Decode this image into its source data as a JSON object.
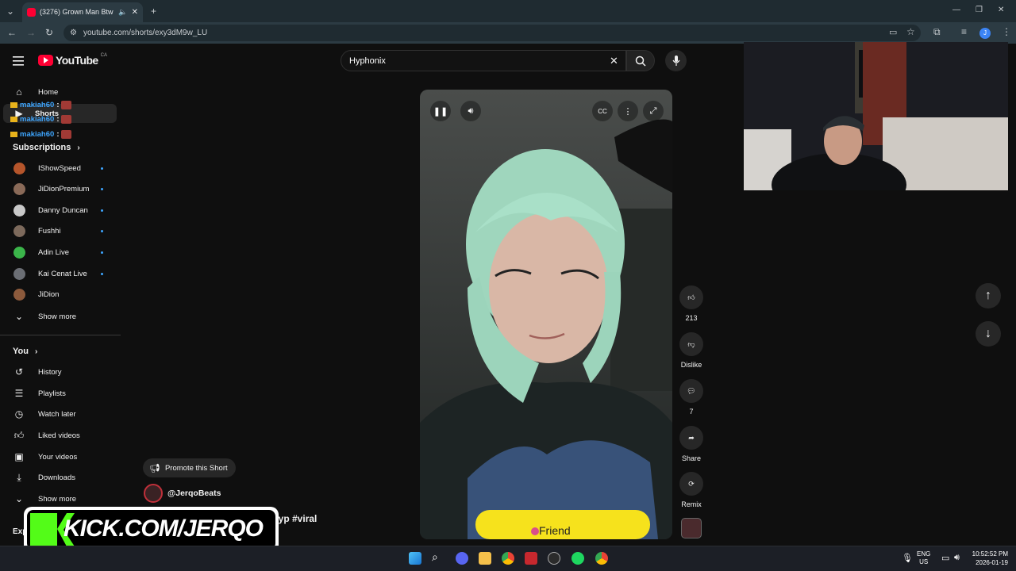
{
  "browser": {
    "tab_title": "(3276) Grown Man Btw 😂",
    "url": "youtube.com/shorts/exy3dM9w_LU"
  },
  "youtube": {
    "logo_text": "YouTube",
    "logo_region": "CA",
    "search_value": "Hyphonix"
  },
  "sidebar": {
    "home": "Home",
    "shorts": "Shorts",
    "subscriptions_title": "Subscriptions",
    "subscriptions": [
      {
        "name": "IShowSpeed",
        "color": "#b5552b"
      },
      {
        "name": "JiDionPremium",
        "color": "#8a6a58"
      },
      {
        "name": "Danny Duncan",
        "color": "#c9c9c9"
      },
      {
        "name": "Fushhi",
        "color": "#7d6a5c"
      },
      {
        "name": "Adin Live",
        "color": "#3bb54a"
      },
      {
        "name": "Kai Cenat Live",
        "color": "#6b6e74"
      },
      {
        "name": "JiDion",
        "color": "#8c5a3c"
      }
    ],
    "show_more_1": "Show more",
    "you_title": "You",
    "you_items": [
      "History",
      "Playlists",
      "Watch later",
      "Liked videos",
      "Your videos",
      "Downloads"
    ],
    "show_more_2": "Show more",
    "explore_partial": "Exp"
  },
  "chat_overlay": {
    "user": "makiah60",
    "sep": ":"
  },
  "short": {
    "promote_label": "Promote this Short",
    "channel": "@JerqoBeats",
    "caption_partial": "#fyp #viral",
    "sticker_text": "Friend"
  },
  "actions": {
    "like_count": "213",
    "dislike_label": "Dislike",
    "comment_count": "7",
    "share_label": "Share",
    "remix_label": "Remix"
  },
  "kick_banner": "KICK.COM/JERQO",
  "taskbar": {
    "lang_top": "ENG",
    "lang_bottom": "US",
    "time": "10:52:52 PM",
    "date": "2026-01-19"
  },
  "colors": {
    "accent": "#3ea6ff",
    "yt_red": "#ff0033",
    "kick_green": "#53fc18"
  }
}
